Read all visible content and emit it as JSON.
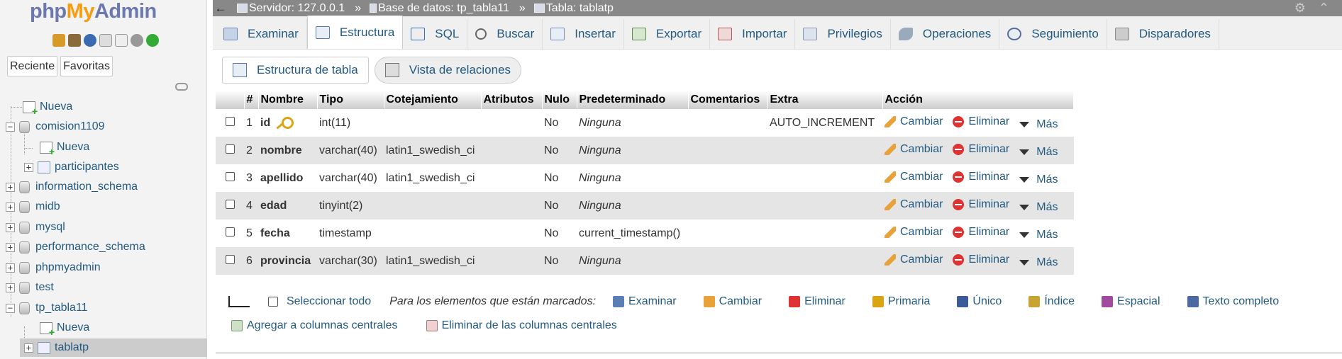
{
  "logo": {
    "part1": "php",
    "part2": "My",
    "part3": "Admin"
  },
  "nav": {
    "tabs": [
      "Reciente",
      "Favoritas"
    ],
    "tree": [
      {
        "label": "Nueva",
        "kind": "new",
        "level": 0
      },
      {
        "label": "comision1109",
        "kind": "db",
        "level": 0,
        "expander": "−"
      },
      {
        "label": "Nueva",
        "kind": "new",
        "level": 1
      },
      {
        "label": "participantes",
        "kind": "table",
        "level": 1,
        "expander": "+"
      },
      {
        "label": "information_schema",
        "kind": "db",
        "level": 0,
        "expander": "+"
      },
      {
        "label": "midb",
        "kind": "db",
        "level": 0,
        "expander": "+"
      },
      {
        "label": "mysql",
        "kind": "db",
        "level": 0,
        "expander": "+"
      },
      {
        "label": "performance_schema",
        "kind": "db",
        "level": 0,
        "expander": "+"
      },
      {
        "label": "phpmyadmin",
        "kind": "db",
        "level": 0,
        "expander": "+"
      },
      {
        "label": "test",
        "kind": "db",
        "level": 0,
        "expander": "+"
      },
      {
        "label": "tp_tabla11",
        "kind": "db",
        "level": 0,
        "expander": "−"
      },
      {
        "label": "Nueva",
        "kind": "new",
        "level": 1
      },
      {
        "label": "tablatp",
        "kind": "table",
        "level": 1,
        "expander": "+",
        "selected": true
      }
    ]
  },
  "breadcrumb": {
    "server": "Servidor: 127.0.0.1",
    "database": "Base de datos: tp_tabla11",
    "table": "Tabla: tablatp",
    "separator": "»"
  },
  "tabs": [
    "Examinar",
    "Estructura",
    "SQL",
    "Buscar",
    "Insertar",
    "Exportar",
    "Importar",
    "Privilegios",
    "Operaciones",
    "Seguimiento",
    "Disparadores"
  ],
  "active_tab": "Estructura",
  "subtabs": [
    "Estructura de tabla",
    "Vista de relaciones"
  ],
  "table": {
    "headers": [
      "#",
      "Nombre",
      "Tipo",
      "Cotejamiento",
      "Atributos",
      "Nulo",
      "Predeterminado",
      "Comentarios",
      "Extra",
      "Acción"
    ],
    "rows": [
      {
        "num": "1",
        "name": "id",
        "primary": true,
        "type": "int(11)",
        "collation": "",
        "attributes": "",
        "null": "No",
        "default": "Ninguna",
        "default_italic": true,
        "comments": "",
        "extra": "AUTO_INCREMENT"
      },
      {
        "num": "2",
        "name": "nombre",
        "type": "varchar(40)",
        "collation": "latin1_swedish_ci",
        "attributes": "",
        "null": "No",
        "default": "Ninguna",
        "default_italic": true,
        "comments": "",
        "extra": ""
      },
      {
        "num": "3",
        "name": "apellido",
        "type": "varchar(40)",
        "collation": "latin1_swedish_ci",
        "attributes": "",
        "null": "No",
        "default": "Ninguna",
        "default_italic": true,
        "comments": "",
        "extra": ""
      },
      {
        "num": "4",
        "name": "edad",
        "type": "tinyint(2)",
        "collation": "",
        "attributes": "",
        "null": "No",
        "default": "Ninguna",
        "default_italic": true,
        "comments": "",
        "extra": ""
      },
      {
        "num": "5",
        "name": "fecha",
        "type": "timestamp",
        "collation": "",
        "attributes": "",
        "null": "No",
        "default": "current_timestamp()",
        "default_italic": false,
        "comments": "",
        "extra": ""
      },
      {
        "num": "6",
        "name": "provincia",
        "type": "varchar(30)",
        "collation": "latin1_swedish_ci",
        "attributes": "",
        "null": "No",
        "default": "Ninguna",
        "default_italic": true,
        "comments": "",
        "extra": ""
      }
    ],
    "actions": {
      "change": "Cambiar",
      "drop": "Eliminar",
      "more": "Más"
    }
  },
  "bulk": {
    "select_all": "Seleccionar todo",
    "with_selected": "Para los elementos que están marcados:",
    "actions": [
      {
        "label": "Examinar",
        "icon": "browse-icon",
        "color": "#5b7fb5"
      },
      {
        "label": "Cambiar",
        "icon": "pencil-icon",
        "color": "#e8a23a"
      },
      {
        "label": "Eliminar",
        "icon": "delete-icon",
        "color": "#dd3333"
      },
      {
        "label": "Primaria",
        "icon": "key-icon",
        "color": "#d9a514"
      },
      {
        "label": "Único",
        "icon": "unique-icon",
        "color": "#3a5a9a"
      },
      {
        "label": "Índice",
        "icon": "index-icon",
        "color": "#c9a334"
      },
      {
        "label": "Espacial",
        "icon": "spatial-icon",
        "color": "#a04aa0"
      },
      {
        "label": "Texto completo",
        "icon": "fulltext-icon",
        "color": "#4a6aa0"
      }
    ],
    "central": [
      "Agregar a columnas centrales",
      "Eliminar de las columnas centrales"
    ]
  },
  "colors": {
    "link": "#235a81",
    "top_bar": "#888888",
    "row_alt": "#e5e5e5",
    "logo_blue": "#6c78af",
    "logo_orange": "#f89c0e"
  }
}
